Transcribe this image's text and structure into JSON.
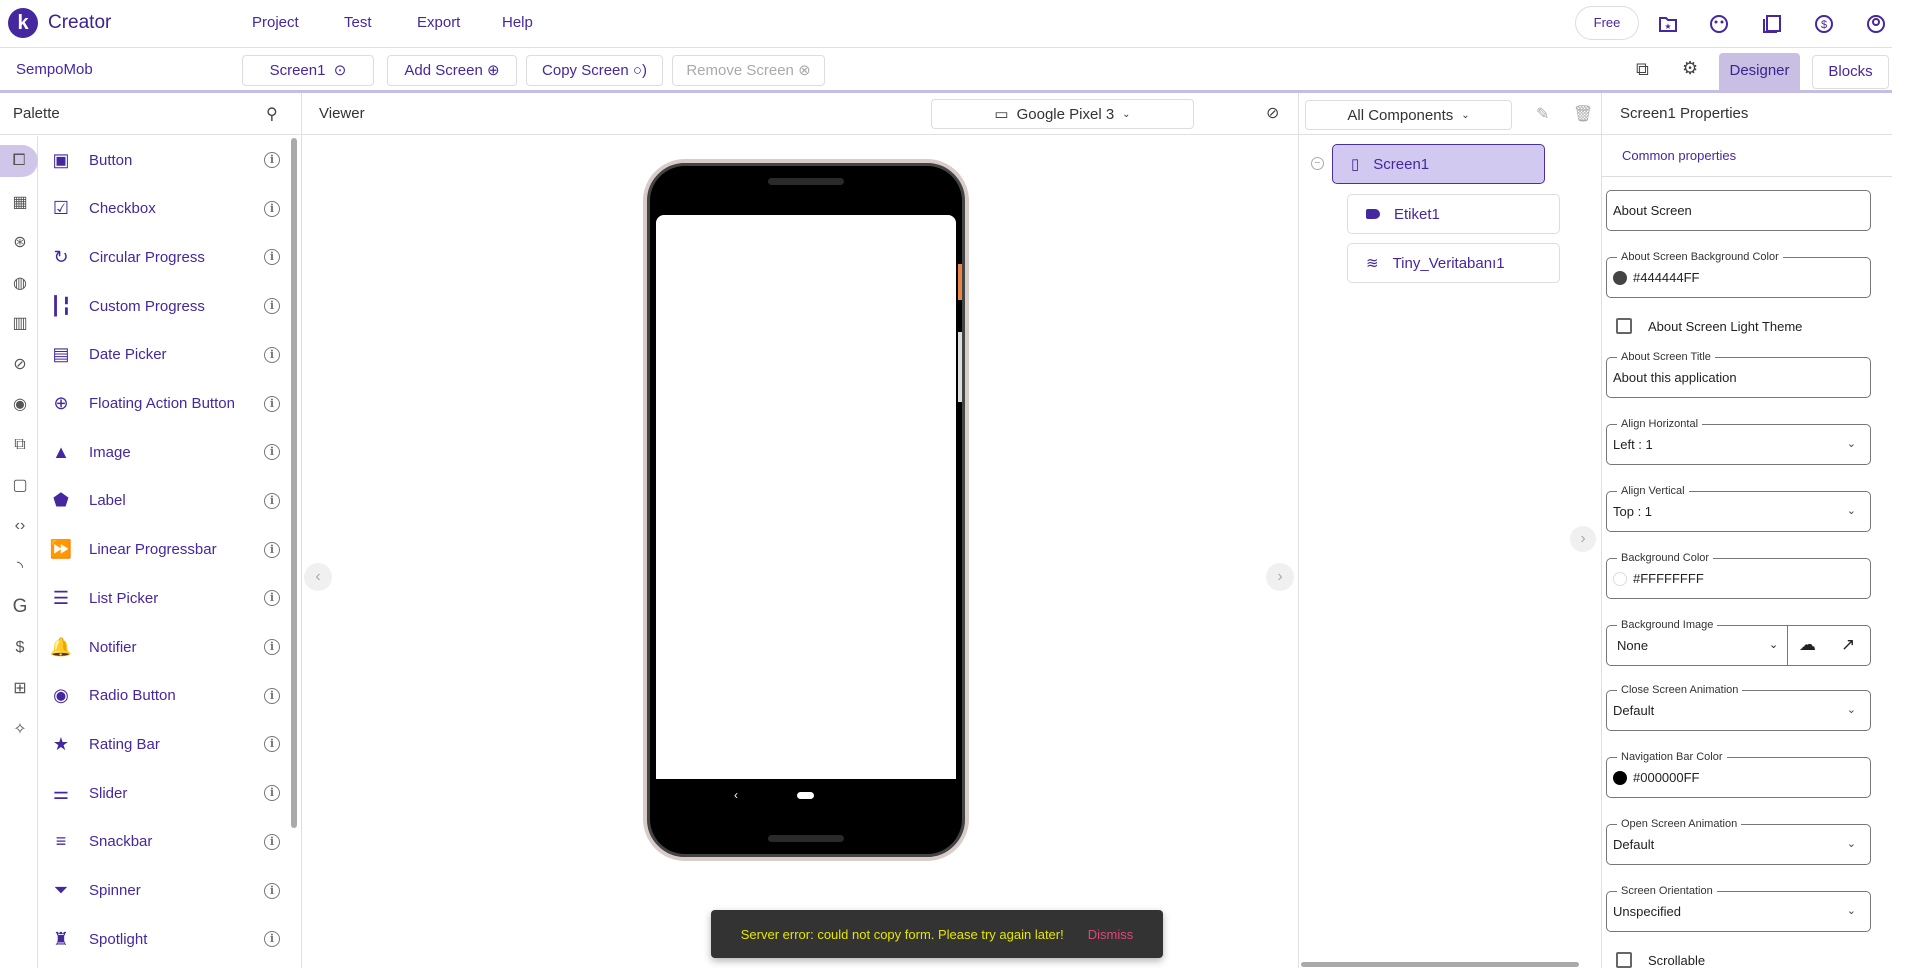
{
  "header": {
    "brand": "Creator",
    "logo_letter": "k",
    "menu": [
      "Project",
      "Test",
      "Export",
      "Help"
    ],
    "plan_badge": "Free"
  },
  "toolbar": {
    "project_name": "SempoMob",
    "screen_select": "Screen1",
    "add_screen": "Add Screen",
    "copy_screen": "Copy Screen",
    "remove_screen": "Remove Screen",
    "designer_tab": "Designer",
    "blocks_tab": "Blocks"
  },
  "palette": {
    "title": "Palette",
    "items": [
      {
        "label": "Button",
        "icon": "button-icon"
      },
      {
        "label": "Checkbox",
        "icon": "checkbox-icon"
      },
      {
        "label": "Circular Progress",
        "icon": "circular-progress-icon"
      },
      {
        "label": "Custom Progress",
        "icon": "custom-progress-icon"
      },
      {
        "label": "Date Picker",
        "icon": "date-picker-icon"
      },
      {
        "label": "Floating Action Button",
        "icon": "fab-icon"
      },
      {
        "label": "Image",
        "icon": "image-icon"
      },
      {
        "label": "Label",
        "icon": "label-icon"
      },
      {
        "label": "Linear Progressbar",
        "icon": "linear-progress-icon"
      },
      {
        "label": "List Picker",
        "icon": "list-picker-icon"
      },
      {
        "label": "Notifier",
        "icon": "bell-icon"
      },
      {
        "label": "Radio Button",
        "icon": "radio-icon"
      },
      {
        "label": "Rating Bar",
        "icon": "star-icon"
      },
      {
        "label": "Slider",
        "icon": "slider-icon"
      },
      {
        "label": "Snackbar",
        "icon": "snackbar-icon"
      },
      {
        "label": "Spinner",
        "icon": "spinner-icon"
      },
      {
        "label": "Spotlight",
        "icon": "spotlight-icon"
      }
    ]
  },
  "viewer": {
    "title": "Viewer",
    "device": "Google Pixel 3"
  },
  "components": {
    "filter": "All Components",
    "tree": [
      {
        "label": "Screen1",
        "selected": true
      },
      {
        "label": "Etiket1"
      },
      {
        "label": "Tiny_Veritabanı1"
      }
    ]
  },
  "properties": {
    "title": "Screen1 Properties",
    "section": "Common properties",
    "about_screen": "About Screen",
    "bg_about": {
      "label": "About Screen Background Color",
      "value": "#444444FF",
      "swatch": "#444444"
    },
    "light_theme": {
      "label": "About Screen Light Theme",
      "checked": false
    },
    "about_title": {
      "label": "About Screen Title",
      "value": "About this application"
    },
    "align_h": {
      "label": "Align Horizontal",
      "value": "Left : 1"
    },
    "align_v": {
      "label": "Align Vertical",
      "value": "Top : 1"
    },
    "bg_color": {
      "label": "Background Color",
      "value": "#FFFFFFFF",
      "swatch": "#FFFFFF"
    },
    "bg_image": {
      "label": "Background Image",
      "value": "None"
    },
    "close_anim": {
      "label": "Close Screen Animation",
      "value": "Default"
    },
    "nav_color": {
      "label": "Navigation Bar Color",
      "value": "#000000FF",
      "swatch": "#000000"
    },
    "open_anim": {
      "label": "Open Screen Animation",
      "value": "Default"
    },
    "orientation": {
      "label": "Screen Orientation",
      "value": "Unspecified"
    },
    "scrollable": {
      "label": "Scrollable",
      "checked": false
    }
  },
  "snackbar": {
    "message": "Server error: could not copy form. Please try again later!",
    "action": "Dismiss"
  },
  "colors": {
    "accent": "#4527a0",
    "selected": "#d2c9f1",
    "snack_text": "#e6e600",
    "snack_action": "#e0457b"
  }
}
